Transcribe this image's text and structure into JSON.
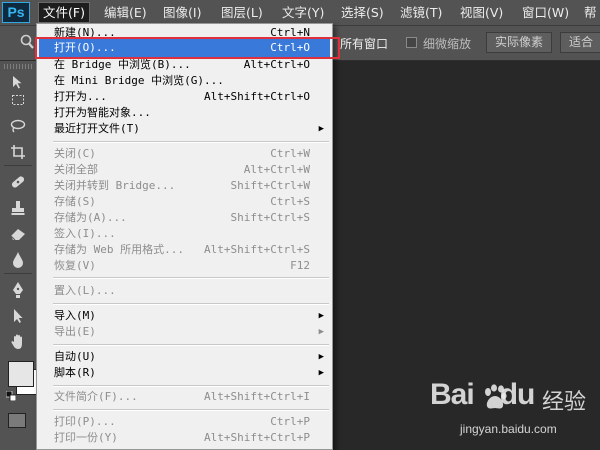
{
  "app": {
    "logo": "Ps"
  },
  "menubar": {
    "items": [
      {
        "label": "文件(F)",
        "active": true
      },
      {
        "label": "编辑(E)"
      },
      {
        "label": "图像(I)"
      },
      {
        "label": "图层(L)"
      },
      {
        "label": "文字(Y)"
      },
      {
        "label": "选择(S)"
      },
      {
        "label": "滤镜(T)"
      },
      {
        "label": "视图(V)"
      },
      {
        "label": "窗口(W)"
      },
      {
        "label": "帮"
      }
    ]
  },
  "options": {
    "all_windows": "所有窗口",
    "scrubby_zoom": "细微缩放",
    "actual_pixels": "实际像素",
    "fit_screen": "适合"
  },
  "tools": [
    "move-tool-icon",
    "marquee-tool-icon",
    "lasso-tool-icon",
    "crop-tool-icon",
    "healing-brush-icon",
    "clone-stamp-icon",
    "eraser-icon",
    "blur-drop-icon",
    "pen-tool-icon",
    "path-selection-icon",
    "hand-tool-icon"
  ],
  "file_menu": {
    "items": [
      {
        "label": "新建(N)...",
        "shortcut": "Ctrl+N"
      },
      {
        "label": "打开(O)...",
        "shortcut": "Ctrl+O",
        "selected": true
      },
      {
        "label": "在 Bridge 中浏览(B)...",
        "shortcut": "Alt+Ctrl+O"
      },
      {
        "label": "在 Mini Bridge 中浏览(G)...",
        "shortcut": ""
      },
      {
        "label": "打开为...",
        "shortcut": "Alt+Shift+Ctrl+O"
      },
      {
        "label": "打开为智能对象...",
        "shortcut": ""
      },
      {
        "label": "最近打开文件(T)",
        "shortcut": "",
        "submenu": true
      },
      {
        "label": "关闭(C)",
        "shortcut": "Ctrl+W",
        "disabled": true
      },
      {
        "label": "关闭全部",
        "shortcut": "Alt+Ctrl+W",
        "disabled": true
      },
      {
        "label": "关闭并转到 Bridge...",
        "shortcut": "Shift+Ctrl+W",
        "disabled": true
      },
      {
        "label": "存储(S)",
        "shortcut": "Ctrl+S",
        "disabled": true
      },
      {
        "label": "存储为(A)...",
        "shortcut": "Shift+Ctrl+S",
        "disabled": true
      },
      {
        "label": "签入(I)...",
        "shortcut": "",
        "disabled": true
      },
      {
        "label": "存储为 Web 所用格式...",
        "shortcut": "Alt+Shift+Ctrl+S",
        "disabled": true
      },
      {
        "label": "恢复(V)",
        "shortcut": "F12",
        "disabled": true
      },
      {
        "label": "置入(L)...",
        "shortcut": "",
        "disabled": true
      },
      {
        "label": "导入(M)",
        "shortcut": "",
        "submenu": true
      },
      {
        "label": "导出(E)",
        "shortcut": "",
        "submenu": true,
        "disabled": true
      },
      {
        "label": "自动(U)",
        "shortcut": "",
        "submenu": true
      },
      {
        "label": "脚本(R)",
        "shortcut": "",
        "submenu": true
      },
      {
        "label": "文件简介(F)...",
        "shortcut": "Alt+Shift+Ctrl+I",
        "disabled": true
      },
      {
        "label": "打印(P)...",
        "shortcut": "Ctrl+P",
        "disabled": true
      },
      {
        "label": "打印一份(Y)",
        "shortcut": "Alt+Shift+Ctrl+P",
        "disabled": true
      }
    ]
  },
  "watermark": {
    "logo": "Bai",
    "logo_end": "du",
    "suffix": "经验",
    "url": "jingyan.baidu.com"
  },
  "colors": {
    "highlight": "#3879d9",
    "annotation_border": "#e0303c",
    "chrome": "#535353",
    "canvas": "#282828"
  }
}
